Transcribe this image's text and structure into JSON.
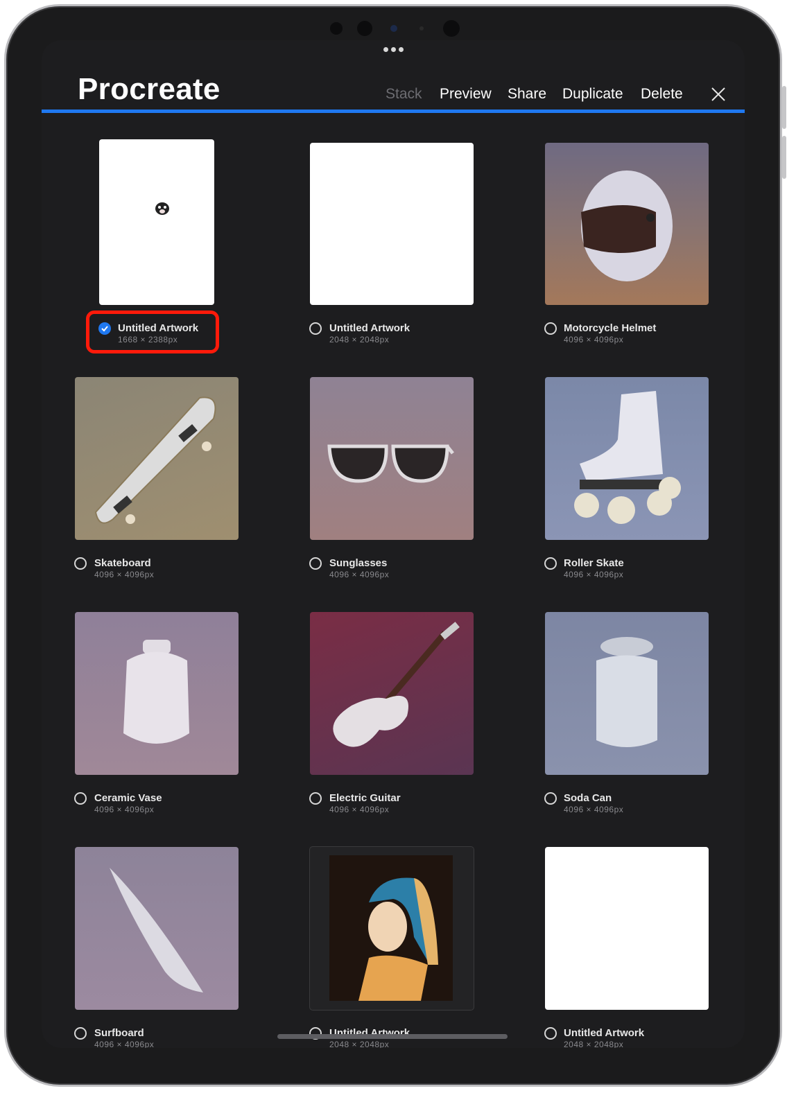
{
  "app": {
    "title": "Procreate",
    "accent_color": "#1f78f0",
    "highlight_color": "#ff1a0a"
  },
  "toolbar": {
    "stack_label": "Stack",
    "preview_label": "Preview",
    "share_label": "Share",
    "duplicate_label": "Duplicate",
    "delete_label": "Delete",
    "close_icon": "close-icon"
  },
  "artworks": [
    {
      "name": "Untitled Artwork",
      "size": "1668 × 2388px",
      "selected": true
    },
    {
      "name": "Untitled Artwork",
      "size": "2048 × 2048px",
      "selected": false
    },
    {
      "name": "Motorcycle Helmet",
      "size": "4096 × 4096px",
      "selected": false
    },
    {
      "name": "Skateboard",
      "size": "4096 × 4096px",
      "selected": false
    },
    {
      "name": "Sunglasses",
      "size": "4096 × 4096px",
      "selected": false
    },
    {
      "name": "Roller Skate",
      "size": "4096 × 4096px",
      "selected": false
    },
    {
      "name": "Ceramic Vase",
      "size": "4096 × 4096px",
      "selected": false
    },
    {
      "name": "Electric Guitar",
      "size": "4096 × 4096px",
      "selected": false
    },
    {
      "name": "Soda Can",
      "size": "4096 × 4096px",
      "selected": false
    },
    {
      "name": "Surfboard",
      "size": "4096 × 4096px",
      "selected": false
    },
    {
      "name": "Untitled Artwork",
      "size": "2048 × 2048px",
      "selected": false
    },
    {
      "name": "Untitled Artwork",
      "size": "2048 × 2048px",
      "selected": false
    }
  ]
}
